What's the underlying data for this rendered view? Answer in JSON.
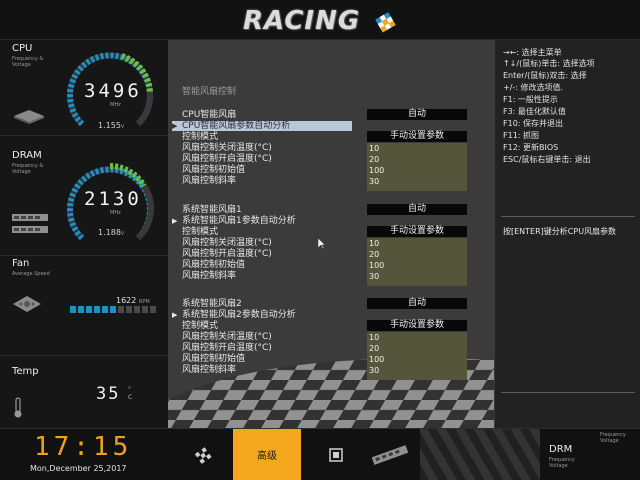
{
  "header": {
    "logo_text": "RACING"
  },
  "sidebar": {
    "cpu": {
      "title": "CPU",
      "sub": "Frequency & Voltage",
      "value": "3496",
      "unit": "MHz",
      "volt": "1.155",
      "volt_unit": "V"
    },
    "dram": {
      "title": "DRAM",
      "sub": "Frequency & Voltage",
      "value": "2130",
      "unit": "MHz",
      "volt": "1.188",
      "volt_unit": "V"
    },
    "fan": {
      "title": "Fan",
      "sub": "Average Speed",
      "rpm": "1622",
      "rpm_unit": "RPM",
      "level_fraction": 0.55
    },
    "temp": {
      "title": "Temp",
      "value": "35",
      "unit_deg": "°",
      "unit_c": "C"
    }
  },
  "main": {
    "title": "智能风扇控制",
    "groups": [
      {
        "name": "CPU智能风扇",
        "name_value": "自动",
        "auto": "CPU智能风扇参数自动分析",
        "mode": "控制模式",
        "mode_value": "手动设置参数",
        "rows": [
          {
            "label": "风扇控制关闭温度(°C)",
            "value": "10"
          },
          {
            "label": "风扇控制开启温度(°C)",
            "value": "20"
          },
          {
            "label": "风扇控制初始值",
            "value": "100"
          },
          {
            "label": "风扇控制斜率",
            "value": "30"
          }
        ]
      },
      {
        "name": "系统智能风扇1",
        "name_value": "自动",
        "auto": "系统智能风扇1参数自动分析",
        "mode": "控制模式",
        "mode_value": "手动设置参数",
        "rows": [
          {
            "label": "风扇控制关闭温度(°C)",
            "value": "10"
          },
          {
            "label": "风扇控制开启温度(°C)",
            "value": "20"
          },
          {
            "label": "风扇控制初始值",
            "value": "100"
          },
          {
            "label": "风扇控制斜率",
            "value": "30"
          }
        ]
      },
      {
        "name": "系统智能风扇2",
        "name_value": "自动",
        "auto": "系统智能风扇2参数自动分析",
        "mode": "控制模式",
        "mode_value": "手动设置参数",
        "rows": [
          {
            "label": "风扇控制关闭温度(°C)",
            "value": "10"
          },
          {
            "label": "风扇控制开启温度(°C)",
            "value": "20"
          },
          {
            "label": "风扇控制初始值",
            "value": "100"
          },
          {
            "label": "风扇控制斜率",
            "value": "30"
          }
        ]
      }
    ]
  },
  "help": {
    "lines": [
      "→←: 选择主菜单",
      "↑↓/(鼠标)单击: 选择选项",
      "Enter/(鼠标)双击: 选择",
      "+/-: 修改选项值.",
      "F1: 一般性提示",
      "F3: 最佳化默认值",
      "F10: 保存并退出",
      "F11: 抓图",
      "F12: 更新BIOS",
      "ESC/鼠标右键单击: 退出"
    ],
    "description": "按[ENTER]键分析CPU风扇参数"
  },
  "footer": {
    "clock": "17:15",
    "date": "Mon,December  25,2017",
    "active_tab": "高级",
    "drm_title": "DRM",
    "drm_sub": "Frequency Voltage",
    "drm_sub2": "Frequency Voltage"
  },
  "colors": {
    "accent": "#f3a71c",
    "gauge_blue": "#1f8fc6",
    "gauge_green": "#6fbf3a",
    "highlight": "#b9c8d8",
    "olive": "#55553b"
  }
}
